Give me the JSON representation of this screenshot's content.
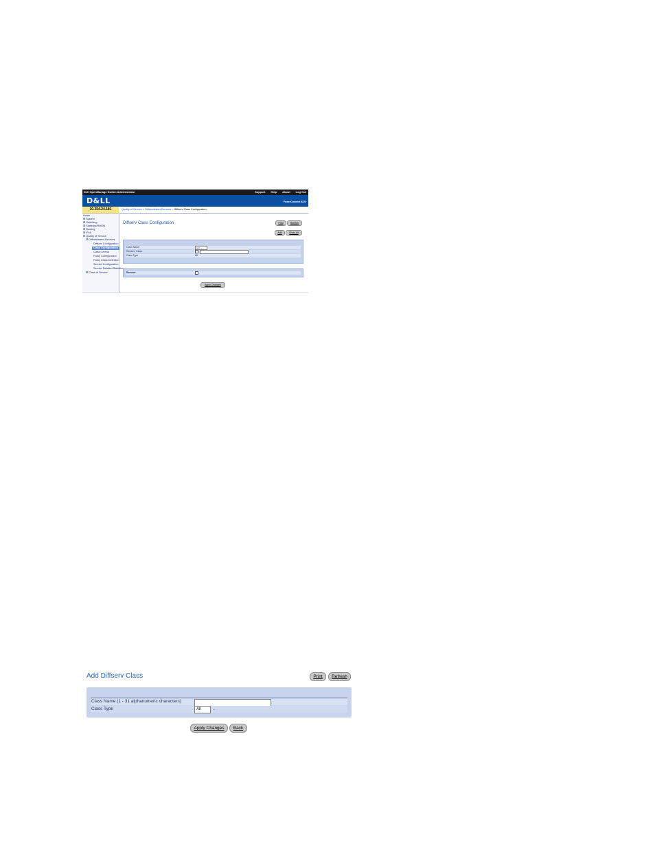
{
  "screen1": {
    "app_title": "Dell OpenManage Switch Administrator",
    "top_links": [
      "Support",
      "Help",
      "About",
      "Log Out"
    ],
    "logo": "D&LL",
    "product": "PowerConnect 6224",
    "ip": "10.254.24.181",
    "breadcrumb": [
      "Quality of Service",
      "Differentiated Services",
      "Diffserv Class Configuration"
    ],
    "breadcrumb_sep": ">",
    "nav": [
      "Home",
      "System",
      "Switching",
      "Statistics/RMON",
      "Routing",
      "IPv6",
      "Quality of Service",
      "Differentiated Services",
      "Diffserv Configuration",
      "Class Configuration",
      "Class Criteria",
      "Policy Configuration",
      "Policy Class Definition",
      "Service Configuration",
      "Service Detailed Statistics",
      "Class of Service"
    ],
    "page_title": "Diffserv Class Configuration",
    "buttons": {
      "print": "Print",
      "refresh": "Refresh",
      "add": "Add",
      "show_all": "Show All",
      "apply": "Apply Changes"
    },
    "form": {
      "class_name_label": "Class Name",
      "class_name_value": "test",
      "rename_label": "Rename Class",
      "class_type_label": "Class Type",
      "class_type_value": "All",
      "remove_label": "Remove"
    }
  },
  "screen2": {
    "title": "Add Diffserv Class",
    "buttons": {
      "print": "Print",
      "refresh": "Refresh",
      "apply": "Apply Changes",
      "back": "Back"
    },
    "form": {
      "class_name_label": "Class Name (1 - 31 alphanumeric characters)",
      "class_name_value": "",
      "class_type_label": "Class Type",
      "class_type_value": "All"
    }
  }
}
